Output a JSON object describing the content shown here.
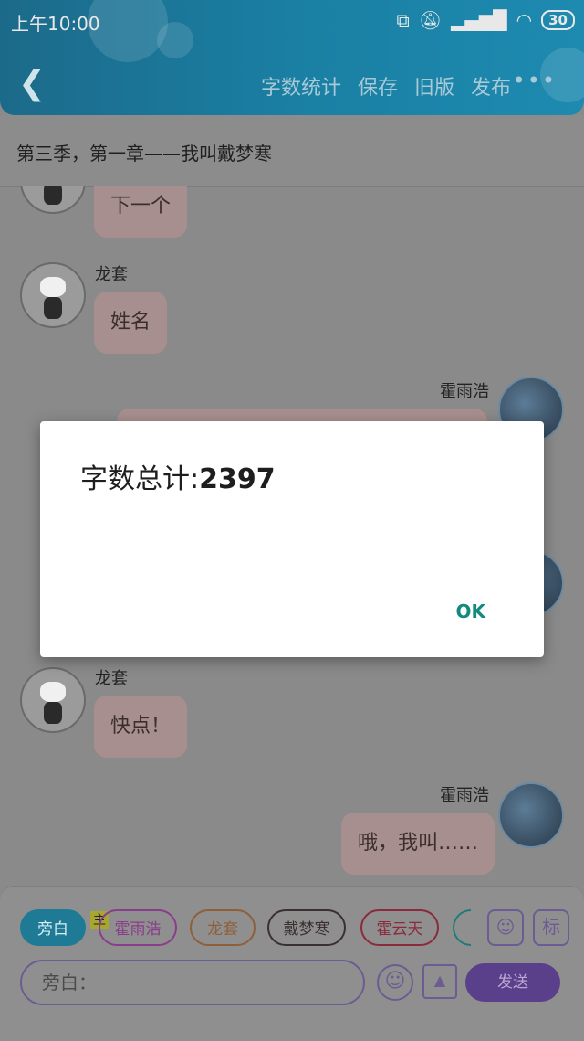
{
  "status_bar": {
    "time": "上午10:00",
    "battery": "30"
  },
  "nav": {
    "items": [
      "字数统计",
      "保存",
      "旧版",
      "发布"
    ],
    "more": "•••"
  },
  "chapter_title": "第三季，第一章——我叫戴梦寒",
  "messages": [
    {
      "speaker": "",
      "text": "下一个"
    },
    {
      "speaker": "龙套",
      "text": "姓名"
    },
    {
      "speaker": "霍雨浩",
      "text": ""
    },
    {
      "speaker": "龙套",
      "text": "快点！"
    },
    {
      "speaker": "霍雨浩",
      "text": "哦，我叫……"
    }
  ],
  "roles": [
    "旁白",
    "霍雨浩",
    "龙套",
    "戴梦寒",
    "霍云天"
  ],
  "role_colors": [
    "#1f7b95",
    "#8a3d8a",
    "#8f5f3a",
    "#3a3030",
    "#8a2a3a"
  ],
  "main_tag": "主",
  "icons": {
    "person": "person-icon",
    "biao": "标"
  },
  "input": {
    "placeholder": "旁白："
  },
  "send_label": "发送",
  "dialog": {
    "label": "字数总计:",
    "value": "2397",
    "ok": "OK"
  }
}
